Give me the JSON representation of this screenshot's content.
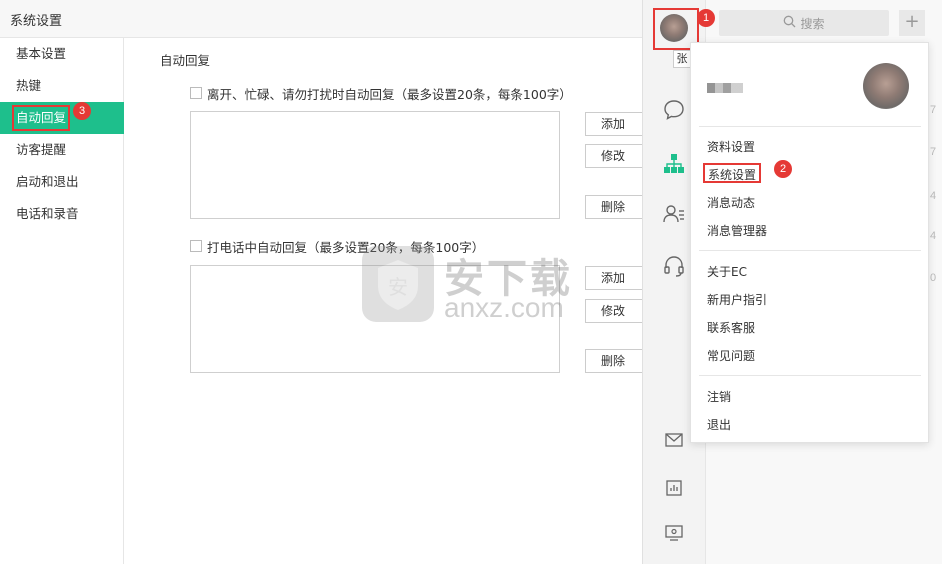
{
  "window": {
    "title": "系统设置"
  },
  "nav": {
    "items": [
      {
        "label": "基本设置"
      },
      {
        "label": "热键"
      },
      {
        "label": "自动回复"
      },
      {
        "label": "访客提醒"
      },
      {
        "label": "启动和退出"
      },
      {
        "label": "电话和录音"
      }
    ]
  },
  "auto_reply": {
    "section_title": "自动回复",
    "away_option": "离开、忙碌、请勿打扰时自动回复（最多设置20条，每条100字）",
    "call_option": "打电话中自动回复（最多设置20条，每条100字）",
    "add_label": "添加",
    "edit_label": "修改",
    "delete_label": "删除"
  },
  "watermark": {
    "text": "安下载",
    "sub": "anxz.com"
  },
  "app": {
    "search_placeholder": "搜索",
    "plus": "+",
    "tooltip": "张"
  },
  "menu": {
    "group1": [
      "资料设置",
      "系统设置",
      "消息动态",
      "消息管理器"
    ],
    "group2": [
      "关于EC",
      "新用户指引",
      "联系客服",
      "常见问题"
    ],
    "group3": [
      "注销",
      "退出"
    ]
  },
  "badges": {
    "one": "1",
    "two": "2",
    "three": "3"
  },
  "partial_numbers": [
    "7",
    "7",
    "4",
    "4",
    "0"
  ],
  "colors": {
    "accent": "#1ebf8c",
    "annotation": "#e53935"
  }
}
